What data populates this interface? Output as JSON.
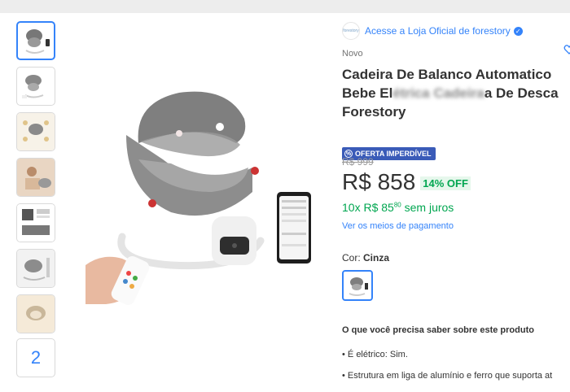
{
  "store": {
    "logo_text": "forestory",
    "link_text": "Acesse a Loja Oficial de forestory"
  },
  "product": {
    "condition": "Novo",
    "title_line1": "Cadeira De Balanco Automatico",
    "title_line2_start": "Bebe El",
    "title_line2_blurred": "étrica Cadeira",
    "title_line2_end": "a De Desca",
    "title_line3": "Forestory"
  },
  "badge": {
    "label": "OFERTA IMPERDÍVEL"
  },
  "pricing": {
    "old_price": "R$ 999",
    "price": "R$ 858",
    "discount": "14% OFF",
    "installments_main": "10x R$ 85",
    "installments_cents": "80",
    "installments_suffix": " sem juros",
    "payment_link": "Ver os meios de pagamento"
  },
  "color": {
    "label": "Cor:",
    "value": "Cinza"
  },
  "gallery": {
    "more_count": "2"
  },
  "features": {
    "title": "O que você precisa saber sobre este produto",
    "items": [
      "É elétrico: Sim.",
      "Estrutura em liga de alumínio e ferro que suporta at"
    ]
  },
  "colors": {
    "accent": "#3483fa",
    "green": "#00a650",
    "badge": "#3a5bb8"
  }
}
